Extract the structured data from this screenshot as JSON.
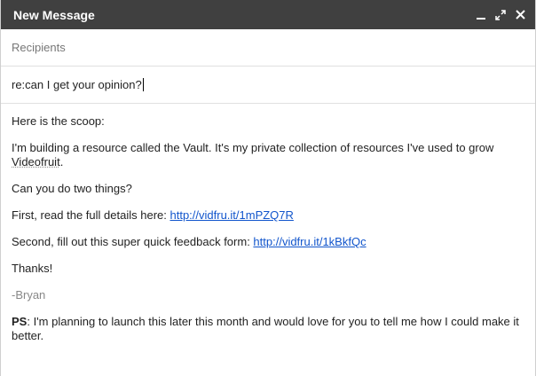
{
  "window": {
    "title": "New Message"
  },
  "compose": {
    "recipients_placeholder": "Recipients",
    "subject": "re:can I get your opinion?"
  },
  "message": {
    "intro": "Here is the scoop:",
    "para1_text": "I'm building a resource called the Vault. It's my private collection of resources I've used to grow ",
    "para1_brand": "Videofruit",
    "para1_end": ".",
    "ask": "Can you do two things?",
    "first_text": "First, read the full details here: ",
    "first_link": "http://vidfru.it/1mPZQ7R",
    "second_text": "Second, fill out this super quick feedback form: ",
    "second_link": "http://vidfru.it/1kBkfQc",
    "thanks": "Thanks!",
    "signature": "-Bryan",
    "ps_label": "PS",
    "ps_text": ": I'm planning to launch this later this month and would love for you to tell me how I could make it better."
  },
  "colors": {
    "titlebar": "#404040",
    "link": "#1155cc"
  },
  "icons": [
    "minimize-icon",
    "expand-icon",
    "close-icon"
  ]
}
